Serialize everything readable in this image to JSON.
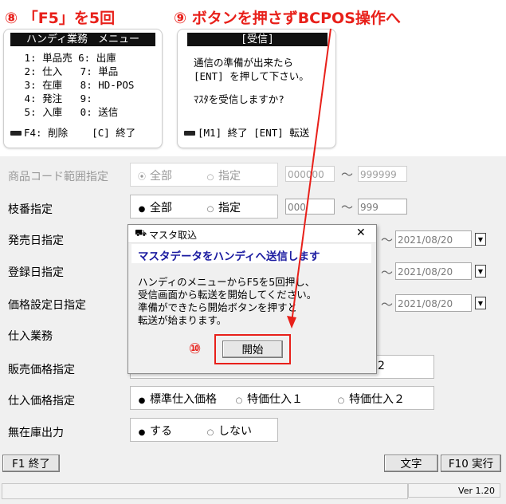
{
  "callouts": {
    "step8": "⑧ 「F5」を5回",
    "step9": "⑨ ボタンを押さずBCPOS操作へ",
    "step10": "⑩"
  },
  "handy_menu": {
    "header": "ハンディ業務　メニュー",
    "lines": [
      " 1: 単品売 6: 出庫",
      " 2: 仕入   7: 単品",
      " 3: 在庫   8: HD-POS",
      " 4: 発注   9:",
      " 5: 入庫   0: 送信"
    ],
    "footer": "F4: 削除    [C] 終了"
  },
  "handy_receive": {
    "header": "[受信]",
    "line1": "通信の準備が出来たら",
    "line2": "[ENT] を押して下さい。",
    "line3": "ﾏｽﾀを受信しますか?",
    "footer": "[M1] 終了 [ENT] 転送"
  },
  "form": {
    "rows": [
      {
        "label": "商品コード範囲指定",
        "opt1": "全部",
        "opt2": "指定",
        "from": "000000",
        "to": "999999"
      },
      {
        "label": "枝番指定",
        "opt1": "全部",
        "opt2": "指定",
        "from": "000",
        "to": "999"
      },
      {
        "label": "発売日指定",
        "date": "2021/08/20"
      },
      {
        "label": "登録日指定",
        "date": "2021/08/20"
      },
      {
        "label": "価格設定日指定",
        "date": "2021/08/20"
      },
      {
        "label": "仕入業務"
      },
      {
        "label": "販売価格指定",
        "partial": "2"
      },
      {
        "label": "仕入価格指定",
        "opt1": "標準仕入価格",
        "opt2": "特価仕入１",
        "opt3": "特価仕入２"
      },
      {
        "label": "無在庫出力",
        "opt1": "する",
        "opt2": "しない"
      }
    ],
    "tilde": "～"
  },
  "footer": {
    "f1": "F1 終了",
    "moji": "文字",
    "f10": "F10 実行",
    "version": "Ver 1.20"
  },
  "dialog": {
    "title": "マスタ取込",
    "close": "✕",
    "heading": "マスタデータをハンディへ送信します",
    "body": [
      "ハンディのメニューからF5を5回押し、",
      "受信画面から転送を開始してください。",
      "準備ができたら開始ボタンを押すと",
      "転送が始まります。"
    ],
    "start": "開始"
  },
  "colors": {
    "accent": "#e8201a",
    "dialog_heading": "#1a1aa0"
  }
}
